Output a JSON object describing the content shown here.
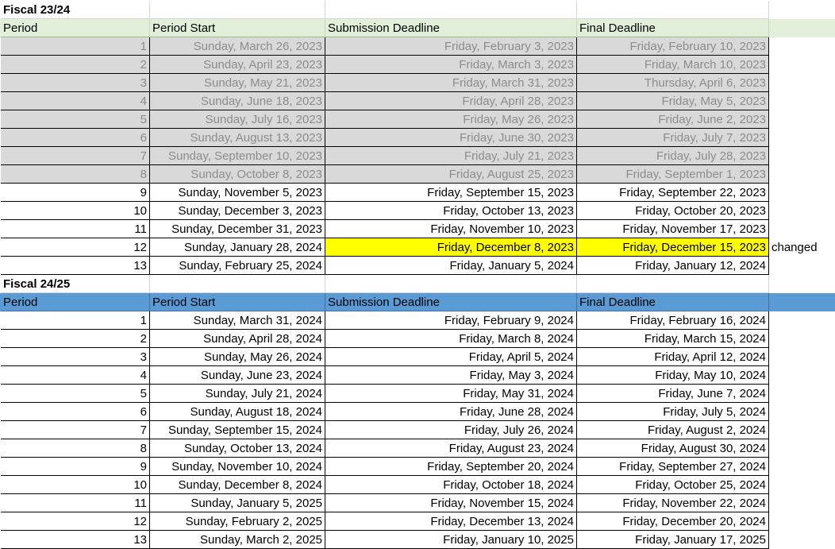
{
  "sections": [
    {
      "title": "Fiscal 23/24",
      "header_style": "green",
      "headers": [
        "Period",
        "Period Start",
        "Submission Deadline",
        "Final Deadline"
      ],
      "rows": [
        {
          "period": "1",
          "start": "Sunday, March 26, 2023",
          "submission": "Friday, February 3, 2023",
          "final": "Friday, February 10, 2023",
          "past": true
        },
        {
          "period": "2",
          "start": "Sunday, April 23, 2023",
          "submission": "Friday, March 3, 2023",
          "final": "Friday, March 10, 2023",
          "past": true
        },
        {
          "period": "3",
          "start": "Sunday, May 21, 2023",
          "submission": "Friday, March 31, 2023",
          "final": "Thursday, April 6, 2023",
          "past": true
        },
        {
          "period": "4",
          "start": "Sunday, June 18, 2023",
          "submission": "Friday, April 28, 2023",
          "final": "Friday, May 5, 2023",
          "past": true
        },
        {
          "period": "5",
          "start": "Sunday, July 16, 2023",
          "submission": "Friday, May 26, 2023",
          "final": "Friday, June 2, 2023",
          "past": true
        },
        {
          "period": "6",
          "start": "Sunday, August 13, 2023",
          "submission": "Friday, June 30, 2023",
          "final": "Friday, July 7, 2023",
          "past": true
        },
        {
          "period": "7",
          "start": "Sunday, September 10, 2023",
          "submission": "Friday, July 21, 2023",
          "final": "Friday, July 28, 2023",
          "past": true
        },
        {
          "period": "8",
          "start": "Sunday, October 8, 2023",
          "submission": "Friday, August 25, 2023",
          "final": "Friday, September 1, 2023",
          "past": true
        },
        {
          "period": "9",
          "start": "Sunday, November 5, 2023",
          "submission": "Friday, September 15, 2023",
          "final": "Friday, September 22, 2023"
        },
        {
          "period": "10",
          "start": "Sunday, December 3, 2023",
          "submission": "Friday, October 13, 2023",
          "final": "Friday, October 20, 2023"
        },
        {
          "period": "11",
          "start": "Sunday, December 31, 2023",
          "submission": "Friday, November 10, 2023",
          "final": "Friday, November 17, 2023"
        },
        {
          "period": "12",
          "start": "Sunday, January 28, 2024",
          "submission": "Friday, December 8, 2023",
          "final": "Friday, December 15, 2023",
          "highlight": true,
          "note": "changed"
        },
        {
          "period": "13",
          "start": "Sunday, February 25, 2024",
          "submission": "Friday, January 5, 2024",
          "final": "Friday, January 12, 2024"
        }
      ]
    },
    {
      "title": "Fiscal 24/25",
      "header_style": "blue",
      "headers": [
        "Period",
        "Period Start",
        "Submission Deadline",
        "Final Deadline"
      ],
      "rows": [
        {
          "period": "1",
          "start": "Sunday, March 31, 2024",
          "submission": "Friday, February 9, 2024",
          "final": "Friday, February 16, 2024"
        },
        {
          "period": "2",
          "start": "Sunday, April 28, 2024",
          "submission": "Friday, March 8, 2024",
          "final": "Friday, March 15, 2024"
        },
        {
          "period": "3",
          "start": "Sunday, May 26, 2024",
          "submission": "Friday, April 5, 2024",
          "final": "Friday, April 12, 2024"
        },
        {
          "period": "4",
          "start": "Sunday, June 23, 2024",
          "submission": "Friday, May 3, 2024",
          "final": "Friday, May 10, 2024"
        },
        {
          "period": "5",
          "start": "Sunday, July 21, 2024",
          "submission": "Friday, May 31, 2024",
          "final": "Friday, June 7, 2024"
        },
        {
          "period": "6",
          "start": "Sunday, August 18, 2024",
          "submission": "Friday, June 28, 2024",
          "final": "Friday, July 5, 2024"
        },
        {
          "period": "7",
          "start": "Sunday, September 15, 2024",
          "submission": "Friday, July 26, 2024",
          "final": "Friday, August 2, 2024"
        },
        {
          "period": "8",
          "start": "Sunday, October 13, 2024",
          "submission": "Friday, August 23, 2024",
          "final": "Friday, August 30, 2024"
        },
        {
          "period": "9",
          "start": "Sunday, November 10, 2024",
          "submission": "Friday, September 20, 2024",
          "final": "Friday, September 27, 2024"
        },
        {
          "period": "10",
          "start": "Sunday, December 8, 2024",
          "submission": "Friday, October 18, 2024",
          "final": "Friday, October 25, 2024"
        },
        {
          "period": "11",
          "start": "Sunday, January 5, 2025",
          "submission": "Friday, November 15, 2024",
          "final": "Friday, November 22, 2024"
        },
        {
          "period": "12",
          "start": "Sunday, February 2, 2025",
          "submission": "Friday, December 13, 2024",
          "final": "Friday, December 20, 2024"
        },
        {
          "period": "13",
          "start": "Sunday, March 2, 2025",
          "submission": "Friday, January 10, 2025",
          "final": "Friday, January 17, 2025"
        }
      ]
    }
  ],
  "colors": {
    "header_green": "#e2efda",
    "header_blue": "#5b9bd5",
    "past_fill": "#d9d9d9",
    "past_text": "#8c8c8c",
    "highlight": "#ffff00"
  }
}
